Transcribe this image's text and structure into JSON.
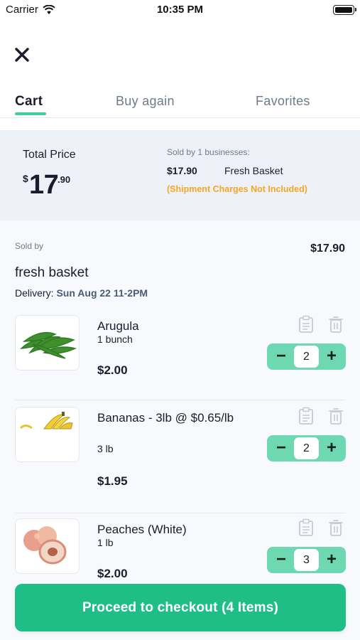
{
  "status_bar": {
    "carrier": "Carrier",
    "time": "10:35 PM"
  },
  "tabs": [
    {
      "label": "Cart",
      "active": true
    },
    {
      "label": "Buy again",
      "active": false
    },
    {
      "label": "Favorites",
      "active": false
    }
  ],
  "summary": {
    "title": "Total Price",
    "currency": "$",
    "dollars": "17",
    "cents": ".90",
    "sold_by_count": "Sold by 1 businesses:",
    "business_amount": "$17.90",
    "business_name": "Fresh Basket",
    "shipment_note": "(Shipment Charges Not Included)"
  },
  "store": {
    "sold_by_label": "Sold by",
    "total": "$17.90",
    "name": "fresh basket",
    "delivery_label": "Delivery:",
    "delivery_slot": "Sun Aug 22 11-2PM"
  },
  "items": [
    {
      "name": "Arugula",
      "unit": "1 bunch",
      "price": "$2.00",
      "qty": "2",
      "image": "arugula"
    },
    {
      "name": "Bananas - 3lb @ $0.65/lb",
      "unit": "3 lb",
      "price": "$1.95",
      "qty": "2",
      "image": "bananas"
    },
    {
      "name": "Peaches (White)",
      "unit": "1 lb",
      "price": "$2.00",
      "qty": "3",
      "image": "peaches"
    }
  ],
  "stepper": {
    "minus": "−",
    "plus": "+"
  },
  "checkout_label": "Proceed to checkout (4 Items)",
  "colors": {
    "accent": "#1fbe87",
    "stepper": "#6ed8b3",
    "warning": "#f5a623",
    "summary_bg": "#eef2f8"
  }
}
